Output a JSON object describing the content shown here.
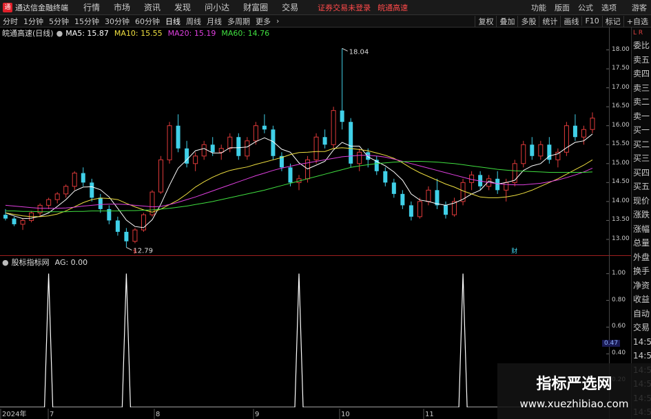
{
  "app": {
    "title": "通达信金融终端",
    "logo_glyph": "通",
    "menu": [
      "行情",
      "市场",
      "资讯",
      "发现",
      "问小达",
      "财富圈",
      "交易"
    ],
    "status": "证券交易未登录",
    "security_name": "皖通高速",
    "right_menu": [
      "功能",
      "版面",
      "公式",
      "选项"
    ],
    "user": "游客"
  },
  "toolbar": {
    "periods": [
      "分时",
      "1分钟",
      "5分钟",
      "15分钟",
      "30分钟",
      "60分钟",
      "日线",
      "周线",
      "月线",
      "多周期",
      "更多"
    ],
    "active_period": "日线",
    "more_arrow": "›",
    "right_tools": [
      "复权",
      "叠加",
      "多股",
      "统计",
      "画线",
      "F10",
      "标记",
      "+自选"
    ]
  },
  "legend": {
    "name": "皖通高速(日线)",
    "ma": [
      {
        "label": "MA5: 15.87",
        "color": "#ffffff"
      },
      {
        "label": "MA10: 15.55",
        "color": "#f0e040"
      },
      {
        "label": "MA20: 15.19",
        "color": "#e040e0"
      },
      {
        "label": "MA60: 14.76",
        "color": "#40e040"
      }
    ]
  },
  "indicator": {
    "name": "股标指标网",
    "value_label": "AG: 0.00",
    "current_value": "0.47"
  },
  "side_panel": [
    "委比",
    "卖五",
    "卖四",
    "卖三",
    "卖二",
    "卖一",
    "买一",
    "买二",
    "买三",
    "买四",
    "买五",
    "现价",
    "涨跌",
    "涨幅",
    "总量",
    "外盘",
    "换手",
    "净资",
    "收益",
    "自动",
    "交易",
    "14:56",
    "14:56",
    "14:56",
    "14:56",
    "14:56",
    "14:56",
    "14:56"
  ],
  "side_top": "L R",
  "x_labels": [
    "2024年",
    "7",
    "8",
    "9",
    "10",
    "11"
  ],
  "marks": {
    "low_label": "12.79",
    "high_label": "18.04",
    "event_a": "$",
    "event_b": "财"
  },
  "watermark": {
    "title": "指标严选网",
    "url": "www.xuezhibiao.com"
  },
  "chart_data": [
    {
      "type": "candlestick",
      "title": "皖通高速(日线)",
      "ylim": [
        12.6,
        18.3
      ],
      "y_ticks": [
        13.0,
        13.5,
        14.0,
        14.5,
        15.0,
        15.5,
        16.0,
        16.5,
        17.0,
        17.5,
        18.0
      ],
      "ohlc": [
        [
          13.65,
          13.8,
          13.5,
          13.55
        ],
        [
          13.55,
          13.6,
          13.35,
          13.4
        ],
        [
          13.4,
          13.55,
          13.25,
          13.5
        ],
        [
          13.5,
          13.75,
          13.45,
          13.7
        ],
        [
          13.7,
          13.95,
          13.6,
          13.9
        ],
        [
          13.9,
          14.1,
          13.8,
          14.05
        ],
        [
          14.05,
          14.25,
          13.95,
          14.2
        ],
        [
          14.2,
          14.45,
          14.1,
          14.4
        ],
        [
          14.4,
          14.8,
          14.3,
          14.75
        ],
        [
          14.75,
          14.9,
          14.4,
          14.5
        ],
        [
          14.5,
          14.6,
          14.0,
          14.1
        ],
        [
          14.1,
          14.2,
          13.7,
          13.8
        ],
        [
          13.8,
          13.9,
          13.4,
          13.5
        ],
        [
          13.5,
          13.6,
          13.1,
          13.2
        ],
        [
          13.2,
          13.3,
          12.79,
          12.95
        ],
        [
          12.95,
          13.3,
          12.9,
          13.25
        ],
        [
          13.25,
          13.7,
          13.2,
          13.65
        ],
        [
          13.65,
          14.3,
          13.6,
          14.25
        ],
        [
          14.25,
          15.2,
          14.2,
          15.1
        ],
        [
          15.1,
          16.1,
          15.0,
          16.0
        ],
        [
          16.0,
          16.3,
          15.3,
          15.4
        ],
        [
          15.4,
          15.6,
          14.9,
          15.0
        ],
        [
          15.0,
          15.3,
          14.8,
          15.2
        ],
        [
          15.2,
          15.6,
          15.1,
          15.5
        ],
        [
          15.5,
          15.7,
          15.2,
          15.3
        ],
        [
          15.3,
          15.5,
          15.1,
          15.4
        ],
        [
          15.4,
          15.8,
          15.3,
          15.7
        ],
        [
          15.7,
          15.8,
          15.1,
          15.2
        ],
        [
          15.2,
          15.7,
          15.1,
          15.6
        ],
        [
          15.6,
          16.1,
          15.5,
          16.0
        ],
        [
          16.0,
          16.3,
          15.8,
          15.9
        ],
        [
          15.9,
          16.0,
          15.1,
          15.2
        ],
        [
          15.2,
          15.3,
          14.8,
          14.9
        ],
        [
          14.9,
          15.0,
          14.4,
          14.5
        ],
        [
          14.5,
          14.7,
          14.3,
          14.6
        ],
        [
          14.6,
          15.2,
          14.5,
          15.1
        ],
        [
          15.1,
          15.8,
          15.0,
          15.7
        ],
        [
          15.7,
          15.9,
          15.4,
          15.5
        ],
        [
          15.5,
          16.5,
          15.4,
          16.4
        ],
        [
          16.4,
          18.04,
          15.9,
          16.1
        ],
        [
          16.1,
          16.2,
          14.9,
          15.0
        ],
        [
          15.0,
          15.4,
          14.8,
          15.3
        ],
        [
          15.3,
          15.4,
          14.9,
          15.1
        ],
        [
          15.1,
          15.2,
          14.7,
          14.8
        ],
        [
          14.8,
          14.9,
          14.4,
          14.5
        ],
        [
          14.5,
          14.6,
          14.1,
          14.2
        ],
        [
          14.2,
          14.3,
          13.8,
          13.9
        ],
        [
          13.9,
          14.0,
          13.5,
          13.6
        ],
        [
          13.6,
          14.1,
          13.55,
          14.0
        ],
        [
          14.0,
          14.4,
          13.9,
          14.3
        ],
        [
          14.3,
          14.6,
          13.8,
          13.9
        ],
        [
          13.9,
          14.0,
          13.55,
          13.65
        ],
        [
          13.65,
          14.1,
          13.6,
          14.0
        ],
        [
          14.0,
          14.6,
          13.9,
          14.5
        ],
        [
          14.5,
          14.8,
          14.3,
          14.7
        ],
        [
          14.7,
          14.8,
          14.3,
          14.4
        ],
        [
          14.4,
          14.7,
          14.3,
          14.6
        ],
        [
          14.6,
          14.8,
          14.2,
          14.3
        ],
        [
          14.3,
          14.6,
          14.0,
          14.5
        ],
        [
          14.5,
          15.1,
          14.4,
          15.0
        ],
        [
          15.0,
          15.6,
          14.9,
          15.5
        ],
        [
          15.5,
          15.7,
          15.1,
          15.2
        ],
        [
          15.2,
          15.6,
          15.1,
          15.5
        ],
        [
          15.5,
          15.7,
          15.0,
          15.1
        ],
        [
          15.1,
          15.4,
          14.9,
          15.3
        ],
        [
          15.3,
          16.1,
          15.2,
          16.0
        ],
        [
          16.0,
          16.3,
          15.6,
          15.7
        ],
        [
          15.7,
          16.0,
          15.5,
          15.9
        ],
        [
          15.9,
          16.35,
          15.8,
          16.2
        ]
      ],
      "series": [
        {
          "name": "MA5",
          "color": "#ffffff",
          "values": [
            13.7,
            13.62,
            13.55,
            13.56,
            13.61,
            13.7,
            13.87,
            14.05,
            14.28,
            14.38,
            14.39,
            14.31,
            14.12,
            13.82,
            13.51,
            13.34,
            13.31,
            13.52,
            13.93,
            14.43,
            14.88,
            15.1,
            15.34,
            15.4,
            15.28,
            15.28,
            15.42,
            15.42,
            15.44,
            15.58,
            15.68,
            15.58,
            15.38,
            15.3,
            15.02,
            14.86,
            14.96,
            15.06,
            15.36,
            15.56,
            15.46,
            15.46,
            15.18,
            15.06,
            14.94,
            14.78,
            14.56,
            14.2,
            14.04,
            14.0,
            13.94,
            13.9,
            13.96,
            14.06,
            14.2,
            14.3,
            14.54,
            14.46,
            14.5,
            14.56,
            14.82,
            14.94,
            15.0,
            15.2,
            15.26,
            15.42,
            15.56,
            15.6,
            15.78
          ]
        },
        {
          "name": "MA10",
          "color": "#f0e040",
          "values": [
            13.7,
            13.66,
            13.62,
            13.6,
            13.6,
            13.62,
            13.67,
            13.75,
            13.86,
            13.97,
            14.05,
            14.09,
            14.08,
            14.05,
            13.95,
            13.86,
            13.78,
            13.72,
            13.8,
            13.92,
            14.04,
            14.2,
            14.38,
            14.52,
            14.64,
            14.74,
            14.82,
            14.87,
            14.91,
            14.98,
            15.04,
            15.1,
            15.16,
            15.24,
            15.29,
            15.3,
            15.32,
            15.32,
            15.4,
            15.42,
            15.4,
            15.37,
            15.34,
            15.28,
            15.22,
            15.14,
            15.02,
            14.88,
            14.76,
            14.66,
            14.56,
            14.46,
            14.38,
            14.28,
            14.2,
            14.12,
            14.1,
            14.1,
            14.12,
            14.16,
            14.22,
            14.3,
            14.4,
            14.5,
            14.6,
            14.72,
            14.84,
            14.96,
            15.1
          ]
        },
        {
          "name": "MA20",
          "color": "#e040e0",
          "values": [
            13.9,
            13.88,
            13.86,
            13.84,
            13.82,
            13.82,
            13.82,
            13.83,
            13.85,
            13.88,
            13.9,
            13.92,
            13.93,
            13.93,
            13.92,
            13.9,
            13.88,
            13.86,
            13.87,
            13.92,
            13.98,
            14.05,
            14.12,
            14.2,
            14.28,
            14.36,
            14.44,
            14.52,
            14.6,
            14.68,
            14.75,
            14.82,
            14.88,
            14.93,
            14.98,
            15.02,
            15.06,
            15.1,
            15.14,
            15.18,
            15.2,
            15.22,
            15.22,
            15.2,
            15.17,
            15.12,
            15.06,
            15.0,
            14.94,
            14.88,
            14.82,
            14.76,
            14.7,
            14.64,
            14.58,
            14.54,
            14.5,
            14.47,
            14.45,
            14.44,
            14.44,
            14.46,
            14.48,
            14.52,
            14.57,
            14.63,
            14.7,
            14.78,
            14.88
          ]
        },
        {
          "name": "MA60",
          "color": "#40e040",
          "values": [
            13.75,
            13.75,
            13.74,
            13.74,
            13.73,
            13.73,
            13.73,
            13.73,
            13.74,
            13.74,
            13.75,
            13.75,
            13.75,
            13.75,
            13.76,
            13.76,
            13.77,
            13.78,
            13.8,
            13.82,
            13.85,
            13.88,
            13.92,
            13.96,
            14.0,
            14.05,
            14.1,
            14.15,
            14.2,
            14.25,
            14.3,
            14.36,
            14.42,
            14.48,
            14.54,
            14.6,
            14.66,
            14.72,
            14.78,
            14.84,
            14.9,
            14.94,
            14.97,
            15.0,
            15.02,
            15.04,
            15.05,
            15.06,
            15.06,
            15.05,
            15.04,
            15.02,
            15.0,
            14.97,
            14.94,
            14.91,
            14.88,
            14.85,
            14.83,
            14.81,
            14.8,
            14.79,
            14.78,
            14.77,
            14.77,
            14.77,
            14.77,
            14.77,
            14.78
          ]
        }
      ]
    },
    {
      "type": "line",
      "title": "股标指标网",
      "ylim": [
        0,
        1.05
      ],
      "y_ticks": [
        0.2,
        0.4,
        0.6,
        0.8,
        1.0
      ],
      "series": [
        {
          "name": "AG",
          "color": "#ffffff",
          "spikes_at": [
            5,
            14,
            34,
            53
          ],
          "values_note_excluded": true
        }
      ]
    }
  ]
}
